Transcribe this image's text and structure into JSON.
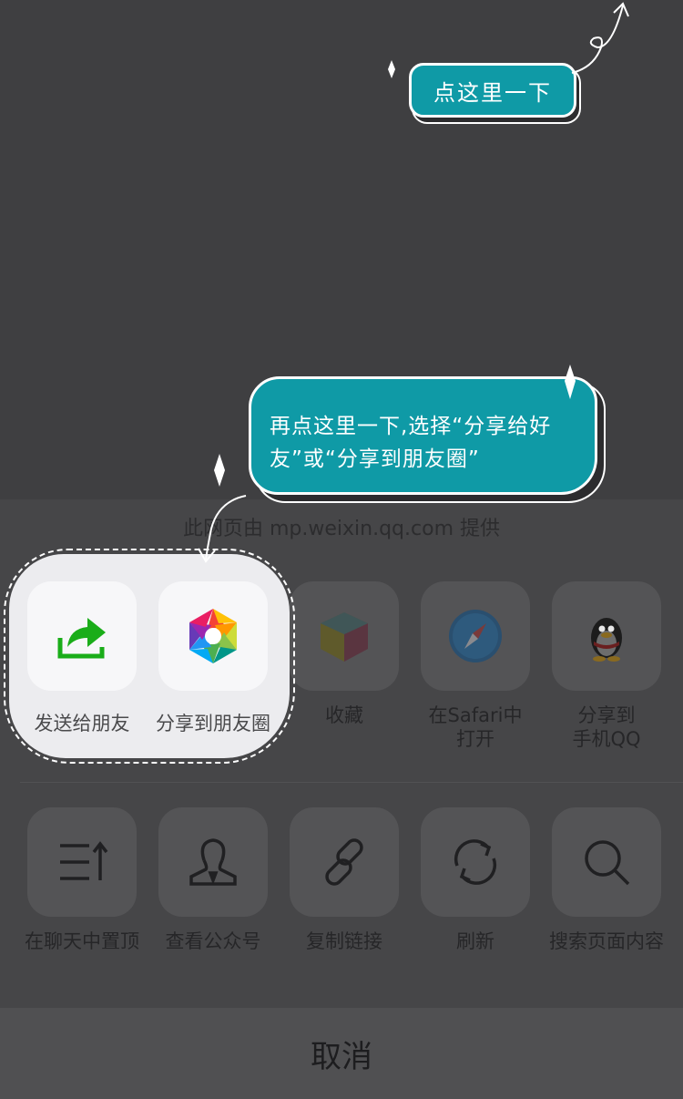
{
  "callouts": {
    "first": "点这里一下",
    "second": "再点这里一下,选择“分享给好友”或“分享到朋友圈”"
  },
  "sheet": {
    "source_text": "此网页由 mp.weixin.qq.com 提供",
    "row1": [
      {
        "label": "发送给朋友",
        "icon": "share-forward-icon"
      },
      {
        "label": "分享到朋友圈",
        "icon": "moments-aperture-icon"
      },
      {
        "label": "收藏",
        "icon": "favorites-cube-icon"
      },
      {
        "label": "在Safari中\n打开",
        "icon": "safari-compass-icon"
      },
      {
        "label": "分享到\n手机QQ",
        "icon": "qq-penguin-icon"
      }
    ],
    "row2": [
      {
        "label": "在聊天中置顶",
        "icon": "pin-to-top-icon"
      },
      {
        "label": "查看公众号",
        "icon": "official-account-icon"
      },
      {
        "label": "复制链接",
        "icon": "link-icon"
      },
      {
        "label": "刷新",
        "icon": "refresh-icon"
      },
      {
        "label": "搜索页面内容",
        "icon": "search-icon"
      }
    ],
    "cancel_label": "取消"
  },
  "colors": {
    "callout": "#0f9aa6",
    "share_green": "#1aad19"
  }
}
